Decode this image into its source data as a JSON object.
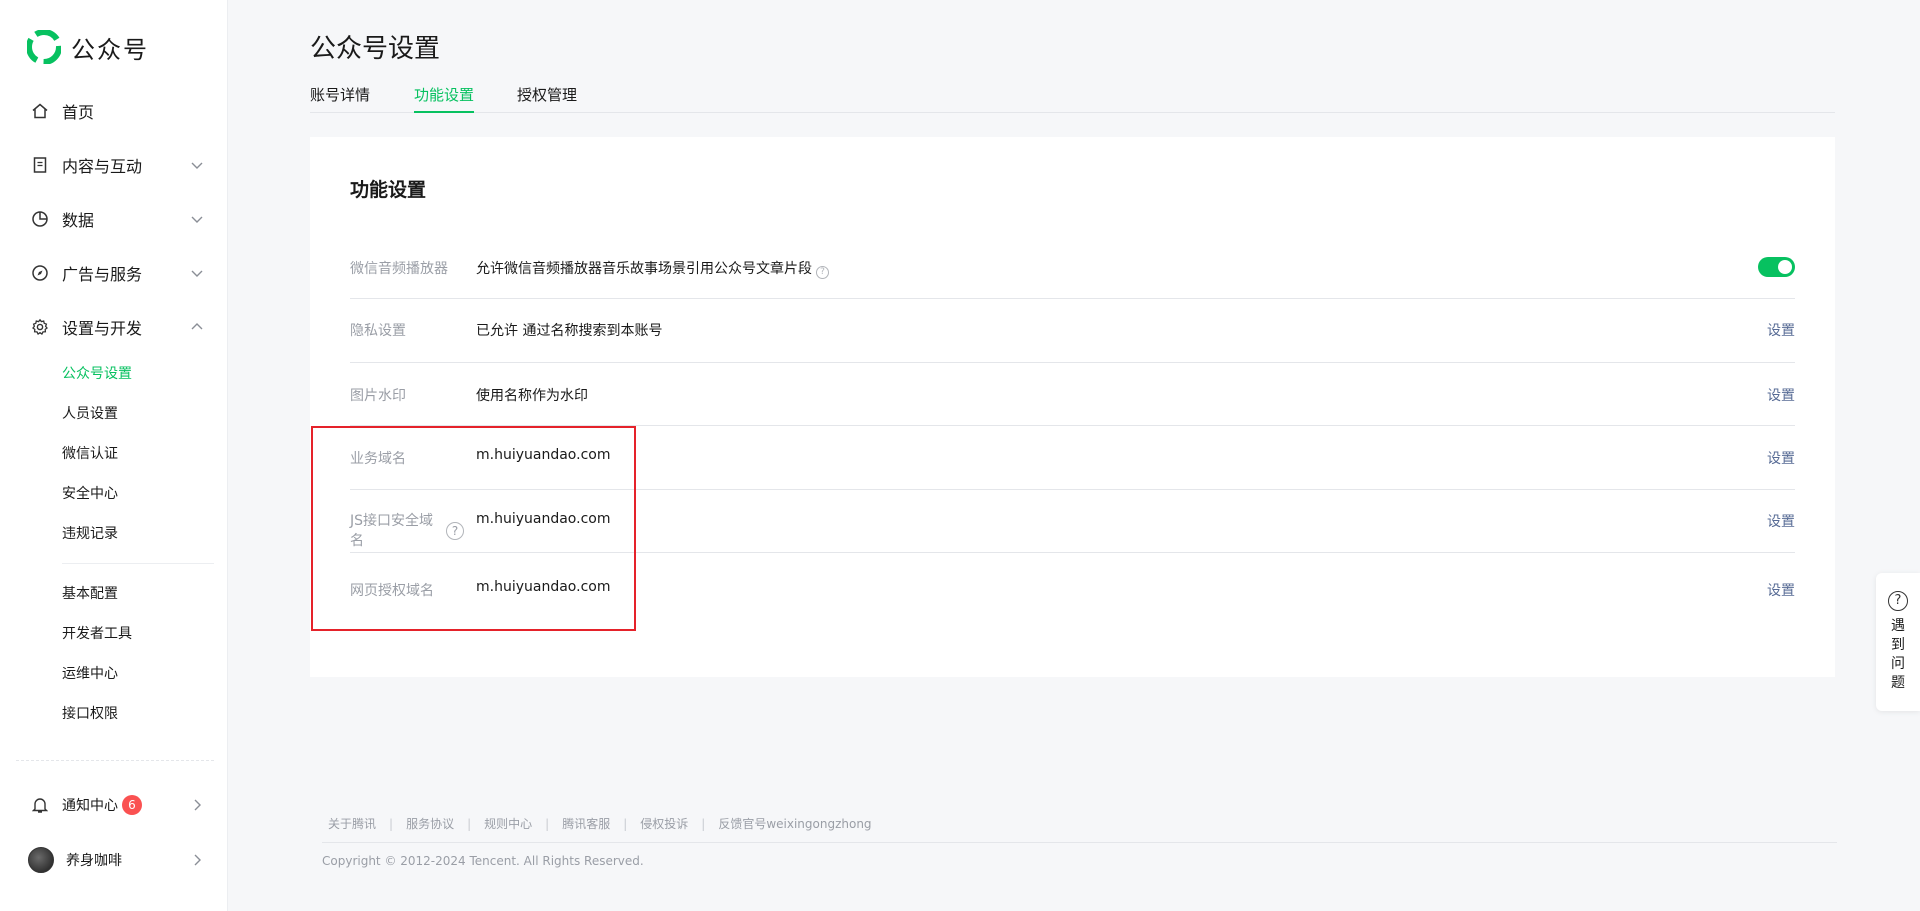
{
  "brand": {
    "name": "公众号",
    "accent": "#07c160",
    "link": "#576b95",
    "alert": "#fa5151"
  },
  "sidebar": {
    "items": [
      {
        "label": "首页",
        "icon": "home-icon"
      },
      {
        "label": "内容与互动",
        "icon": "document-icon"
      },
      {
        "label": "数据",
        "icon": "pie-chart-icon"
      },
      {
        "label": "广告与服务",
        "icon": "compass-icon"
      },
      {
        "label": "设置与开发",
        "icon": "gear-icon"
      }
    ],
    "settings_sub": [
      "公众号设置",
      "人员设置",
      "微信认证",
      "安全中心",
      "违规记录"
    ],
    "dev_sub": [
      "基本配置",
      "开发者工具",
      "运维中心",
      "接口权限"
    ],
    "notification": {
      "label": "通知中心",
      "count": "6"
    },
    "user": {
      "name": "养身咖啡"
    }
  },
  "page": {
    "title": "公众号设置",
    "tabs": [
      "账号详情",
      "功能设置",
      "授权管理"
    ],
    "active_tab": "功能设置"
  },
  "card": {
    "title": "功能设置",
    "rows": [
      {
        "key": "微信音频播放器",
        "value": "允许微信音频播放器音乐故事场景引用公众号文章片段",
        "toggle": true
      },
      {
        "key": "隐私设置",
        "value": "已允许 通过名称搜索到本账号",
        "action": "设置"
      },
      {
        "key": "图片水印",
        "value": "使用名称作为水印",
        "action": "设置"
      },
      {
        "key": "业务域名",
        "value": "m.huiyuandao.com",
        "action": "设置"
      },
      {
        "key_line1": "JS接口安全域",
        "key_line2": "名",
        "value": "m.huiyuandao.com",
        "action": "设置"
      },
      {
        "key": "网页授权域名",
        "value": "m.huiyuandao.com",
        "action": "设置"
      }
    ]
  },
  "footer": {
    "links": [
      "关于腾讯",
      "服务协议",
      "规则中心",
      "腾讯客服",
      "侵权投诉",
      "反馈官号weixingongzhong"
    ],
    "separator": "|",
    "copyright": "Copyright © 2012-2024 Tencent. All Rights Reserved."
  },
  "float_help": {
    "icon": "?",
    "label": "遇到问题"
  }
}
